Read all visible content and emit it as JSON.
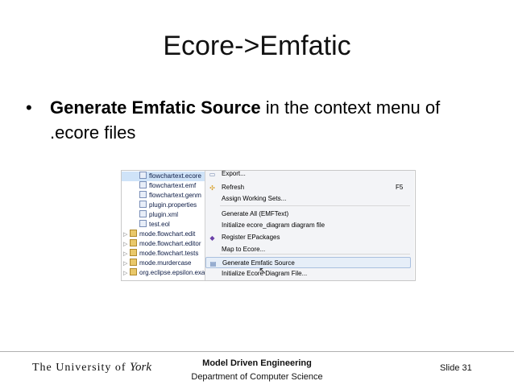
{
  "slide": {
    "title": "Ecore->Emfatic",
    "bullet_symbol": "•",
    "bullet_bold": "Generate Emfatic Source",
    "bullet_rest": " in the context menu of .ecore files"
  },
  "screenshot": {
    "tree": [
      {
        "label": "flowchartext.ecore",
        "arrow": "",
        "icon": "file",
        "indent": 1,
        "selected": true
      },
      {
        "label": "flowchartext.emf",
        "arrow": "",
        "icon": "file",
        "indent": 1,
        "selected": false
      },
      {
        "label": "flowchartext.genm",
        "arrow": "",
        "icon": "file",
        "indent": 1,
        "selected": false
      },
      {
        "label": "plugin.properties",
        "arrow": "",
        "icon": "file",
        "indent": 1,
        "selected": false
      },
      {
        "label": "plugin.xml",
        "arrow": "",
        "icon": "file",
        "indent": 1,
        "selected": false
      },
      {
        "label": "test.eol",
        "arrow": "",
        "icon": "file",
        "indent": 1,
        "selected": false
      },
      {
        "label": "mode.flowchart.edit",
        "arrow": "▷",
        "icon": "folder",
        "indent": 0,
        "selected": false
      },
      {
        "label": "mode.flowchart.editor",
        "arrow": "▷",
        "icon": "folder",
        "indent": 0,
        "selected": false
      },
      {
        "label": "mode.flowchart.tests",
        "arrow": "▷",
        "icon": "folder",
        "indent": 0,
        "selected": false
      },
      {
        "label": "mode.murdercase",
        "arrow": "▷",
        "icon": "folder",
        "indent": 0,
        "selected": false
      },
      {
        "label": "org.eclipse.epsilon.exa",
        "arrow": "▷",
        "icon": "folder",
        "indent": 0,
        "selected": false
      }
    ],
    "menu": [
      {
        "label": "Export...",
        "shortcut": "",
        "icon": "▭",
        "icon_color": "#6a7fa8",
        "highlighted": false
      },
      {
        "label": "Refresh",
        "shortcut": "F5",
        "icon": "✣",
        "icon_color": "#d79a1a",
        "highlighted": false
      },
      {
        "label": "Assign Working Sets...",
        "shortcut": "",
        "icon": "",
        "icon_color": "",
        "highlighted": false
      },
      {
        "label": "Generate All (EMFText)",
        "shortcut": "",
        "icon": "",
        "icon_color": "",
        "highlighted": false
      },
      {
        "label": "Initialize ecore_diagram diagram file",
        "shortcut": "",
        "icon": "",
        "icon_color": "",
        "highlighted": false
      },
      {
        "label": "Register EPackages",
        "shortcut": "",
        "icon": "◆",
        "icon_color": "#6a3fa8",
        "highlighted": false
      },
      {
        "label": "Map to Ecore...",
        "shortcut": "",
        "icon": "",
        "icon_color": "",
        "highlighted": false
      },
      {
        "label": "Generate Emfatic Source",
        "shortcut": "",
        "icon": "▤",
        "icon_color": "#4a6fa8",
        "highlighted": true
      },
      {
        "label": "Initialize Ecore Diagram File...",
        "shortcut": "",
        "icon": "",
        "icon_color": "",
        "highlighted": false
      }
    ]
  },
  "footer": {
    "university_part1": "The University of ",
    "university_part2": "York",
    "course": "Model Driven Engineering",
    "department": "Department of Computer Science",
    "slide_number": "Slide 31"
  }
}
